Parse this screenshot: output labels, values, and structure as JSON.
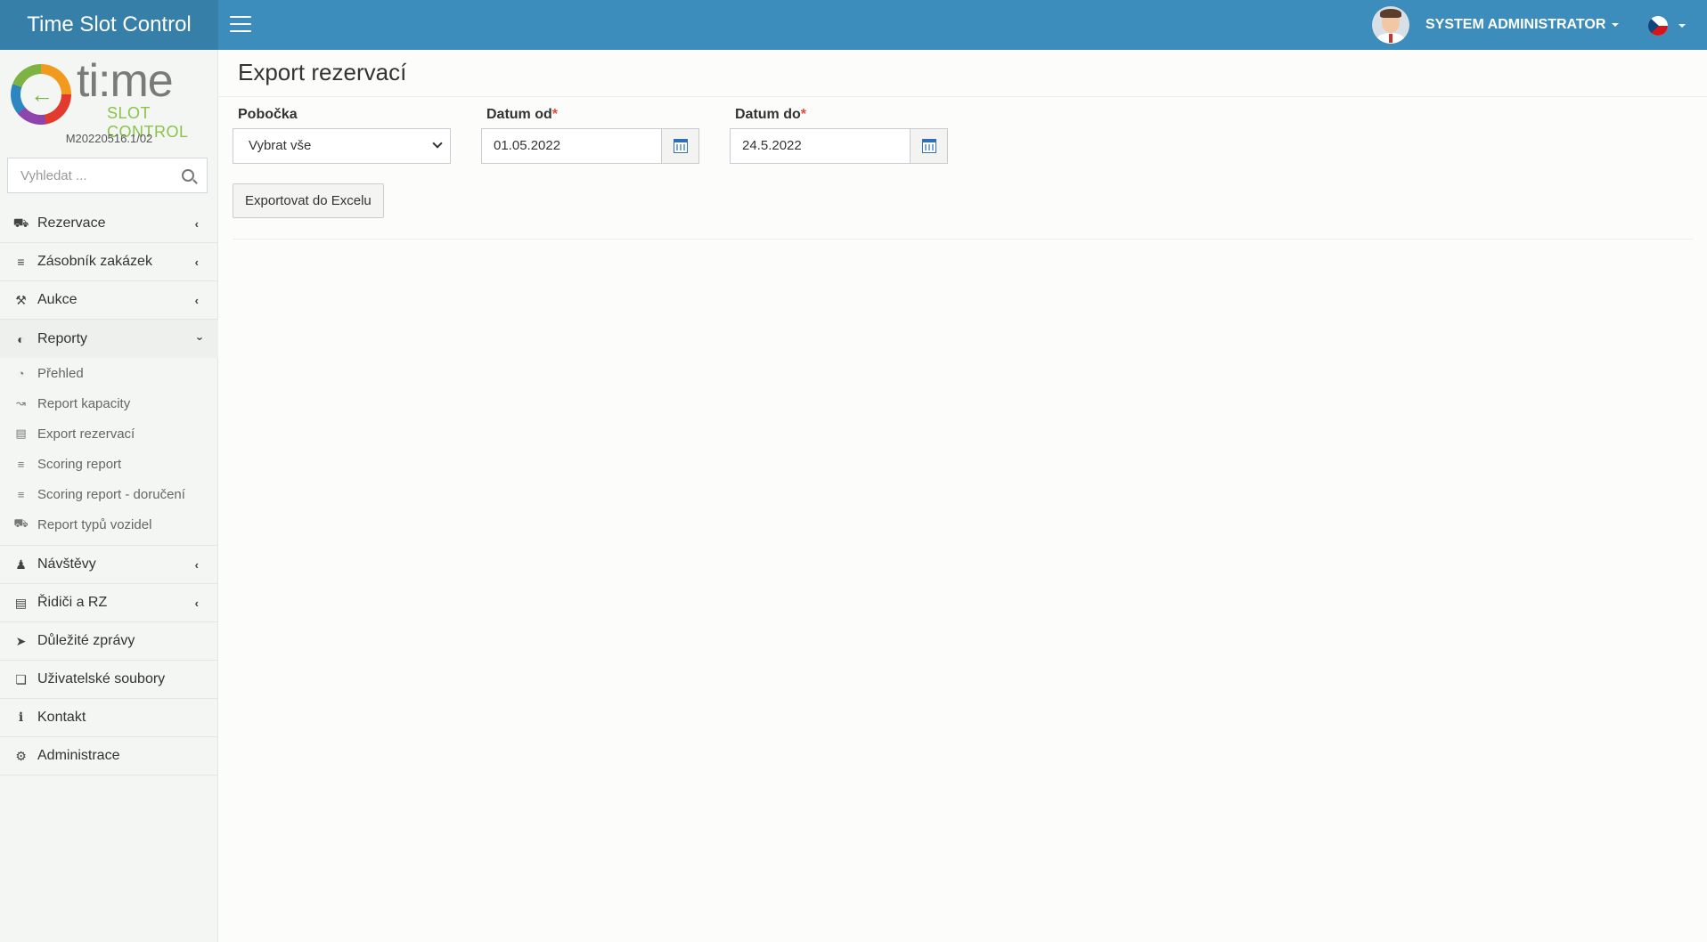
{
  "header": {
    "brand": "Time Slot Control",
    "user_name": "SYSTEM ADMINISTRATOR"
  },
  "sidebar": {
    "logo_text": "ti:me",
    "logo_sub": "SLOT CONTROL",
    "version": "M20220516.1/02",
    "search_placeholder": "Vyhledat ...",
    "items": [
      {
        "label": "Rezervace",
        "icon": "truck-icon"
      },
      {
        "label": "Zásobník zakázek",
        "icon": "stack-icon"
      },
      {
        "label": "Aukce",
        "icon": "gavel-icon"
      },
      {
        "label": "Reporty",
        "icon": "pie-chart-icon"
      },
      {
        "label": "Návštěvy",
        "icon": "users-icon"
      },
      {
        "label": "Řidiči a RZ",
        "icon": "id-card-icon"
      },
      {
        "label": "Důležité zprávy",
        "icon": "megaphone-icon"
      },
      {
        "label": "Uživatelské soubory",
        "icon": "files-icon"
      },
      {
        "label": "Kontakt",
        "icon": "info-icon"
      },
      {
        "label": "Administrace",
        "icon": "gear-icon"
      }
    ],
    "reporty_sub": [
      {
        "label": "Přehled",
        "icon": "dashboard-icon"
      },
      {
        "label": "Report kapacity",
        "icon": "line-chart-icon"
      },
      {
        "label": "Export rezervací",
        "icon": "book-icon"
      },
      {
        "label": "Scoring report",
        "icon": "list-ol-icon"
      },
      {
        "label": "Scoring report - doručení",
        "icon": "list-ol-icon"
      },
      {
        "label": "Report typů vozidel",
        "icon": "truck-icon"
      }
    ]
  },
  "main": {
    "title": "Export rezervací",
    "branch_label": "Pobočka",
    "branch_value": "Vybrat vše",
    "date_from_label": "Datum od",
    "date_from_value": "01.05.2022",
    "date_to_label": "Datum do",
    "date_to_value": "24.5.2022",
    "required_mark": "*",
    "export_button": "Exportovat do Excelu"
  },
  "colors": {
    "header": "#3c8dbc",
    "brand": "#367fa9",
    "required": "#dd4b39"
  }
}
